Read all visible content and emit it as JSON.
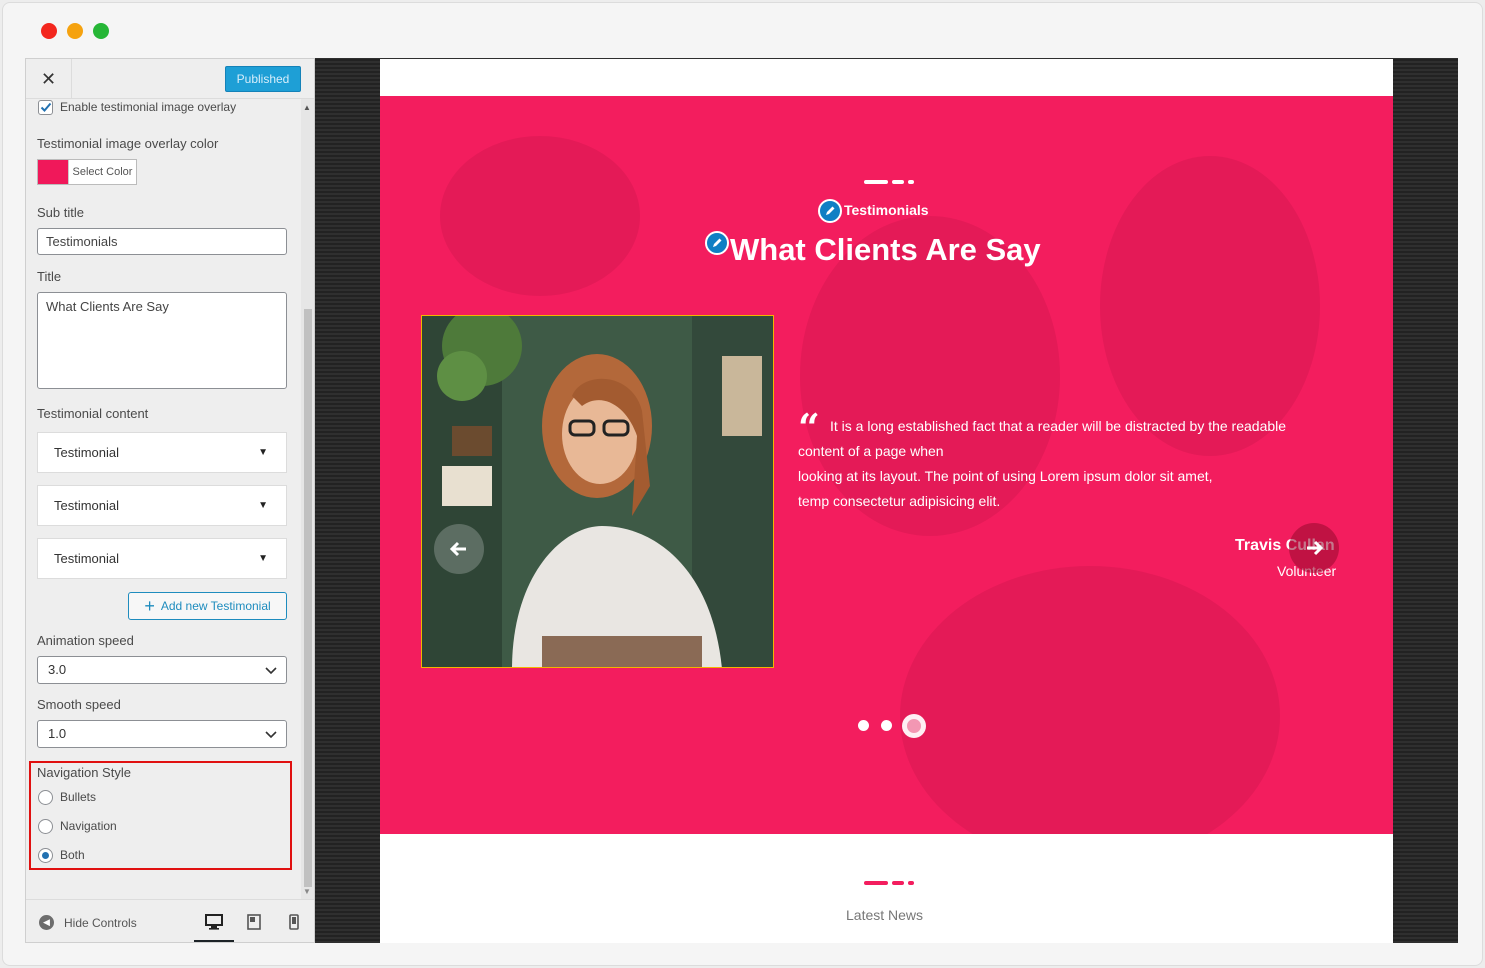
{
  "window": {
    "controls": [
      "close",
      "minimize",
      "maximize"
    ]
  },
  "customizer": {
    "close_icon": "close-icon",
    "publish_label": "Published",
    "overlay_checkbox_label": "Enable testimonial image overlay",
    "overlay_checkbox_checked": true,
    "overlay_color_label": "Testimonial image overlay color",
    "overlay_color": "#f0185a",
    "select_color_label": "Select Color",
    "subtitle_label": "Sub title",
    "subtitle_value": "Testimonials",
    "title_label": "Title",
    "title_value": "What Clients Are Say",
    "content_label": "Testimonial content",
    "testimonials": [
      "Testimonial",
      "Testimonial",
      "Testimonial"
    ],
    "add_button_label": "Add new Testimonial",
    "animation_speed_label": "Animation speed",
    "animation_speed_value": "3.0",
    "smooth_speed_label": "Smooth speed",
    "smooth_speed_value": "1.0",
    "navigation_style_label": "Navigation Style",
    "navigation_options": [
      {
        "label": "Bullets",
        "selected": false
      },
      {
        "label": "Navigation",
        "selected": false
      },
      {
        "label": "Both",
        "selected": true
      }
    ],
    "hide_controls_label": "Hide Controls",
    "devices": [
      "desktop-icon",
      "tablet-icon",
      "mobile-icon"
    ],
    "active_device": "desktop"
  },
  "preview": {
    "accent": "#f31d5e",
    "subtitle": "Testimonials",
    "title": "What Clients Are Say",
    "quote_lines": [
      "It is a long established fact that a reader will be distracted by the readable",
      "content of a page when",
      "looking at its layout. The point of using Lorem ipsum dolor sit amet,",
      "temp consectetur adipisicing elit."
    ],
    "author_name": "Travis Cullan",
    "author_role": "Volunteer",
    "carousel_page_count": 3,
    "carousel_active_index": 2,
    "next_section_title": "Latest News"
  }
}
